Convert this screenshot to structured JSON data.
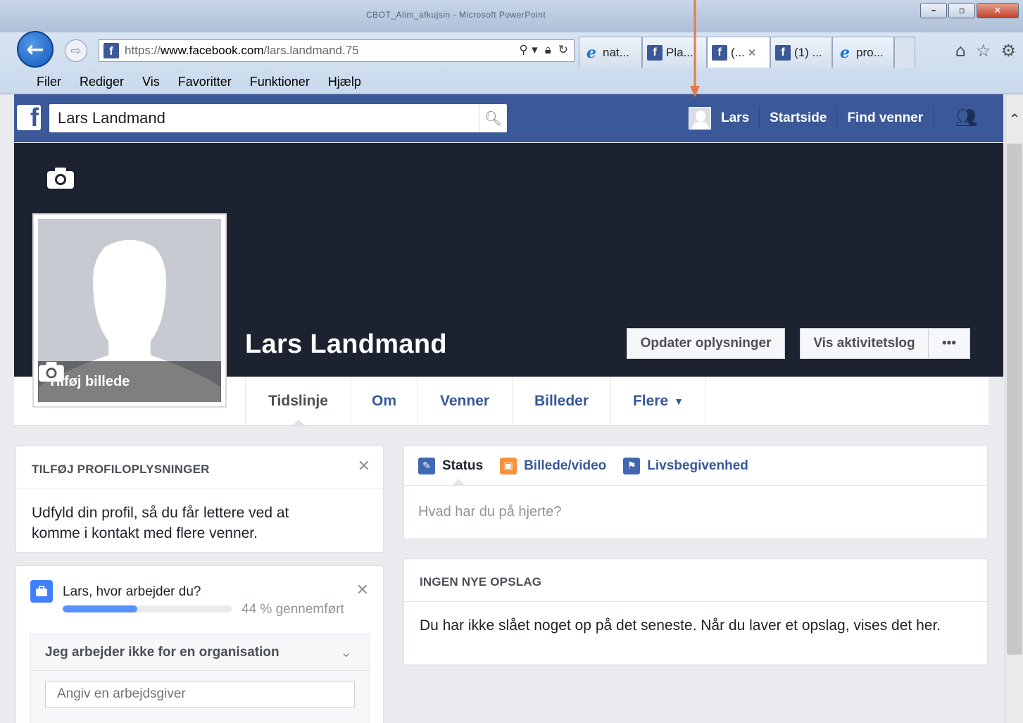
{
  "browser": {
    "window_title": "CBOT_Alim_afkujsin - Microsoft PowerPoint",
    "address": {
      "scheme": "https://",
      "domain": "www.facebook.com",
      "path": "/lars.landmand.75"
    },
    "tabs": [
      {
        "label": "nat...",
        "icon": "ie-icon"
      },
      {
        "label": "Pla...",
        "icon": "facebook-icon"
      },
      {
        "label": "(...",
        "icon": "facebook-icon",
        "active": true
      },
      {
        "label": "(1) ...",
        "icon": "facebook-icon"
      },
      {
        "label": "pro...",
        "icon": "ie-icon"
      }
    ],
    "menu": [
      "Filer",
      "Rediger",
      "Vis",
      "Favoritter",
      "Funktioner",
      "Hjælp"
    ]
  },
  "fb": {
    "search_value": "Lars Landmand",
    "nav": {
      "user": "Lars",
      "home": "Startside",
      "find_friends": "Find venner"
    },
    "accent": "#3b5998"
  },
  "profile": {
    "name": "Lars Landmand",
    "add_photo": "Tilføj billede",
    "update_info": "Opdater oplysninger",
    "activity_log": "Vis aktivitetslog",
    "more_dots": "•••",
    "tabs": [
      "Tidslinje",
      "Om",
      "Venner",
      "Billeder",
      "Flere"
    ]
  },
  "left_card1": {
    "heading": "TILFØJ PROFILOPLYSNINGER",
    "body": "Udfyld din profil, så du får lettere ved at komme i kontakt med flere venner."
  },
  "left_card2": {
    "question": "Lars, hvor arbejder du?",
    "progress": 0.44,
    "progress_label": "44 % gennemført",
    "org_option": "Jeg arbejder ikke for en organisation",
    "employer_placeholder": "Angiv en arbejdsgiver"
  },
  "composer": {
    "status": "Status",
    "photo": "Billede/video",
    "life_event": "Livsbegivenhed",
    "placeholder": "Hvad har du på hjerte?"
  },
  "no_posts": {
    "heading": "INGEN NYE OPSLAG",
    "body": "Du har ikke slået noget op på det seneste. Når du laver et opslag, vises det her."
  }
}
